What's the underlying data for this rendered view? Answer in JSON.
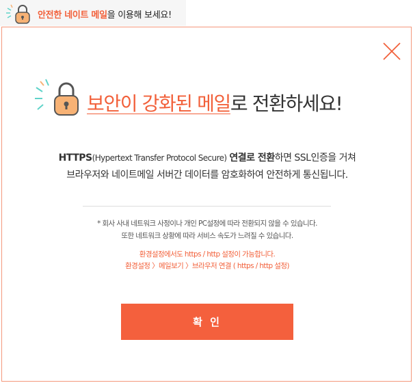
{
  "colors": {
    "accent": "#f2603a",
    "button": "#f4603d",
    "border": "#f4977a",
    "lock_body": "#f7b275",
    "sparkle_teal": "#5fd3c9"
  },
  "top_tab": {
    "icon": "lock-icon",
    "highlight": "안전한 네이트 메일",
    "rest": "을 이용해 보세요!"
  },
  "dialog": {
    "close_icon": "close-icon",
    "headline": {
      "icon": "lock-icon",
      "highlight": "보안이 강화된 메일",
      "rest": "로 전환하세요!"
    },
    "description": {
      "line1_https": "HTTPS",
      "line1_paren": "(Hypertext Transfer Protocol Secure)",
      "line1_bold": "연결로 전환",
      "line1_rest": "하면 SSL인증을 거쳐",
      "line2": "브라우저와 네이트메일 서버간 데이터를 암호화하여 안전하게 통신됩니다."
    },
    "notes": {
      "line1": "* 회사 사내 네트워크 사정이나 개인 PC설정에 따라 전환되지 않을 수 있습니다.",
      "line2": "또한 네트워크 상황에 따라 서비스 속도가 느려질 수 있습니다."
    },
    "settings_notes": {
      "line1": "환경설정에서도 https / http 설정이 가능합니다.",
      "line2": "환경설정 〉메일보기 〉브라우저 연결 ( https / http 설정)"
    },
    "confirm_label": "확 인"
  }
}
